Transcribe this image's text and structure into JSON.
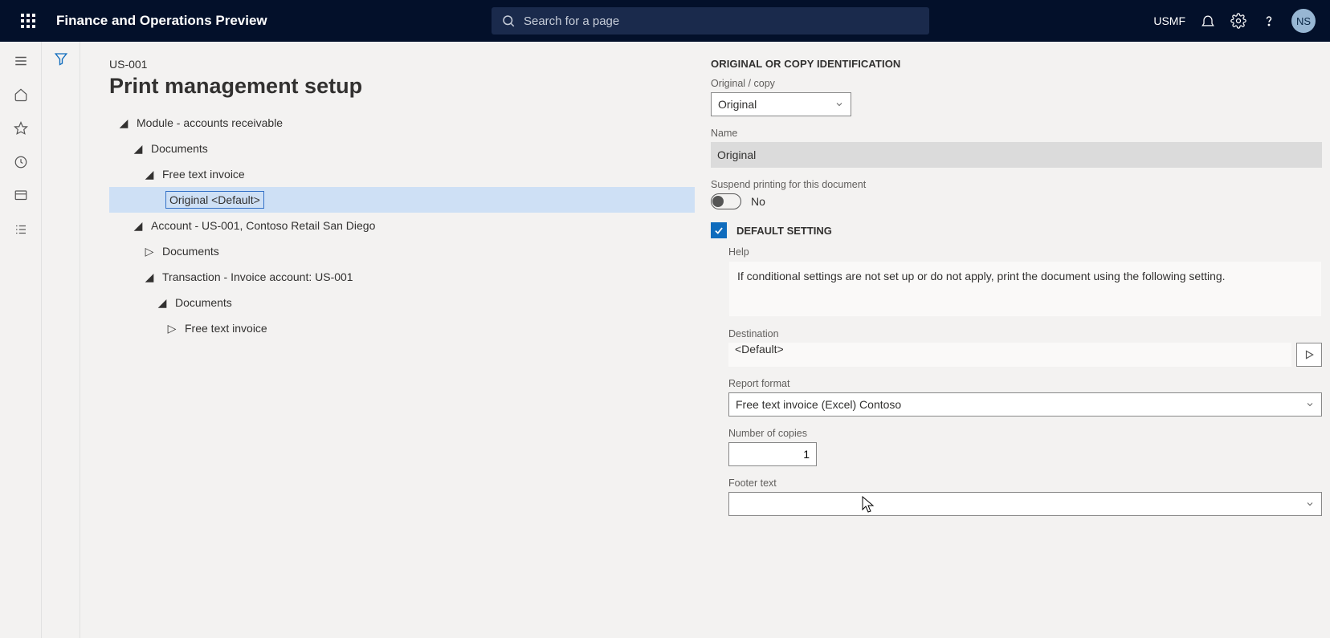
{
  "header": {
    "app_title": "Finance and Operations Preview",
    "search_placeholder": "Search for a page",
    "company": "USMF",
    "avatar": "NS"
  },
  "page": {
    "breadcrumb": "US-001",
    "title": "Print management setup"
  },
  "tree": {
    "module": "Module - accounts receivable",
    "documents1": "Documents",
    "fti": "Free text invoice",
    "original_default": "Original <Default>",
    "account": "Account - US-001, Contoso Retail San Diego",
    "documents2": "Documents",
    "transaction": "Transaction - Invoice account: US-001",
    "documents3": "Documents",
    "fti2": "Free text invoice"
  },
  "form": {
    "section1": "ORIGINAL OR COPY IDENTIFICATION",
    "original_copy_label": "Original / copy",
    "original_copy_value": "Original",
    "name_label": "Name",
    "name_value": "Original",
    "suspend_label": "Suspend printing for this document",
    "suspend_value": "No",
    "default_setting": "DEFAULT SETTING",
    "help_label": "Help",
    "help_text": "If conditional settings are not set up or do not apply, print the document using the following setting.",
    "destination_label": "Destination",
    "destination_value": "<Default>",
    "report_format_label": "Report format",
    "report_format_value": "Free text invoice (Excel) Contoso",
    "copies_label": "Number of copies",
    "copies_value": "1",
    "footer_label": "Footer text",
    "footer_value": ""
  }
}
